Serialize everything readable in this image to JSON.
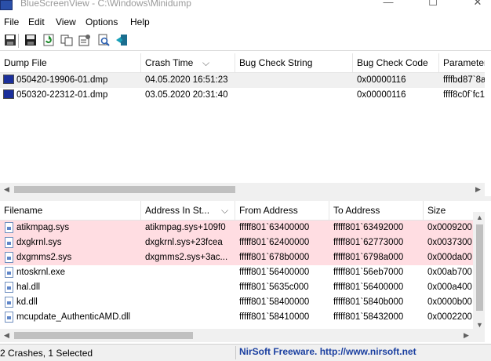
{
  "window": {
    "title": "BlueScreenView  -  C:\\Windows\\Minidump",
    "minimize": "—",
    "maximize": "☐",
    "close": "✕"
  },
  "menu": [
    "File",
    "Edit",
    "View",
    "Options",
    "Help"
  ],
  "toolbar": [
    "save-icon",
    "save-all-icon",
    "refresh-icon",
    "copy-icon",
    "properties-icon",
    "find-icon",
    "exit-icon"
  ],
  "colors": {
    "highlight_row": "#ffdde2",
    "selected_row": "#f0f0f0",
    "link": "#1a3fa0",
    "dump_icon": "#1b2f9b"
  },
  "top": {
    "columns": [
      "Dump File",
      "Crash Time",
      "Bug Check String",
      "Bug Check Code",
      "Parameter"
    ],
    "sort_indicator": "⌵",
    "rows": [
      {
        "cells": [
          "050420-19906-01.dmp",
          "04.05.2020 16:51:23",
          "",
          "0x00000116",
          "ffffbd87`8a"
        ],
        "selected": true
      },
      {
        "cells": [
          "050320-22312-01.dmp",
          "03.05.2020 20:31:40",
          "",
          "0x00000116",
          "ffff8c0f`fc1"
        ],
        "selected": false
      }
    ]
  },
  "bottom": {
    "columns": [
      "Filename",
      "Address In St...",
      "From Address",
      "To Address",
      "Size"
    ],
    "sort_indicator": "⌵",
    "rows": [
      {
        "cells": [
          "atikmpag.sys",
          "atikmpag.sys+109f0",
          "fffff801`63400000",
          "fffff801`63492000",
          "0x00092000"
        ],
        "highlight": true
      },
      {
        "cells": [
          "dxgkrnl.sys",
          "dxgkrnl.sys+23fcea",
          "fffff801`62400000",
          "fffff801`62773000",
          "0x00373000"
        ],
        "highlight": true
      },
      {
        "cells": [
          "dxgmms2.sys",
          "dxgmms2.sys+3ac...",
          "fffff801`678b0000",
          "fffff801`6798a000",
          "0x000da000"
        ],
        "highlight": true
      },
      {
        "cells": [
          "ntoskrnl.exe",
          "",
          "fffff801`56400000",
          "fffff801`56eb7000",
          "0x00ab7000"
        ],
        "highlight": false
      },
      {
        "cells": [
          "hal.dll",
          "",
          "fffff801`5635c000",
          "fffff801`56400000",
          "0x000a4000"
        ],
        "highlight": false
      },
      {
        "cells": [
          "kd.dll",
          "",
          "fffff801`58400000",
          "fffff801`5840b000",
          "0x0000b000"
        ],
        "highlight": false
      },
      {
        "cells": [
          "mcupdate_AuthenticAMD.dll",
          "",
          "fffff801`58410000",
          "fffff801`58432000",
          "0x00022000"
        ],
        "highlight": false
      }
    ]
  },
  "status": {
    "text": "2 Crashes, 1 Selected",
    "link": "NirSoft Freeware.  http://www.nirsoft.net"
  }
}
